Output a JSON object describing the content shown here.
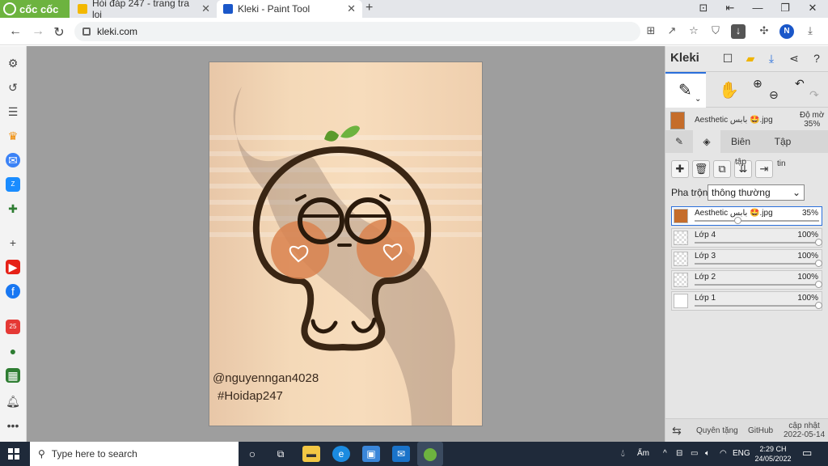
{
  "browser": {
    "brand": "cốc cốc",
    "tabs": [
      {
        "title": "Hỏi đáp 247 - trang tra loi",
        "favicon_color": "#f3b800"
      },
      {
        "title": "Kleki - Paint Tool",
        "favicon_color": "#1a57c9"
      }
    ],
    "url": "kleki.com",
    "user_initial": "N"
  },
  "sidebar": {
    "icons": [
      "settings-icon",
      "history-icon",
      "list-icon",
      "crown-icon",
      "messenger-icon",
      "zalo-icon",
      "gamepad-icon",
      "plus-icon",
      "youtube-icon",
      "facebook-icon",
      "calendar-icon",
      "chat-icon",
      "spreadsheet-icon",
      "bell-icon",
      "more-icon"
    ]
  },
  "artwork": {
    "watermark_line1": "@nguyenngan4028",
    "watermark_line2": "#Hoidap247"
  },
  "kleki": {
    "logo": "Kleki",
    "active_layer_name": "Aesthetic بابس 🤩.jpg",
    "opacity_label": "Độ mờ",
    "opacity_value": "35%",
    "tabs": [
      "Biên",
      "Tập"
    ],
    "action_labels": [
      "tập",
      "tin"
    ],
    "blend_label": "Pha trộn",
    "blend_value": "thông thường",
    "layers": [
      {
        "name": "Aesthetic بابس 🤩.jpg",
        "opacity": "35%",
        "opacity_fraction": 0.35
      },
      {
        "name": "Lớp 4",
        "opacity": "100%",
        "opacity_fraction": 1.0
      },
      {
        "name": "Lớp 3",
        "opacity": "100%",
        "opacity_fraction": 1.0
      },
      {
        "name": "Lớp 2",
        "opacity": "100%",
        "opacity_fraction": 1.0
      },
      {
        "name": "Lớp 1",
        "opacity": "100%",
        "opacity_fraction": 1.0
      }
    ],
    "footer": {
      "donate": "Quyên tặng",
      "github": "GitHub",
      "update_label": "cập nhật",
      "update_date": "2022-05-14"
    }
  },
  "taskbar": {
    "search_placeholder": "Type here to search",
    "weather": "Ẩm",
    "language": "ENG",
    "time": "2:29 CH",
    "date": "24/05/2022"
  },
  "colors": {
    "kleki_accent": "#2a6fdb",
    "coccoc_green": "#6db33f",
    "taskbar_bg": "#1f2a3a"
  }
}
